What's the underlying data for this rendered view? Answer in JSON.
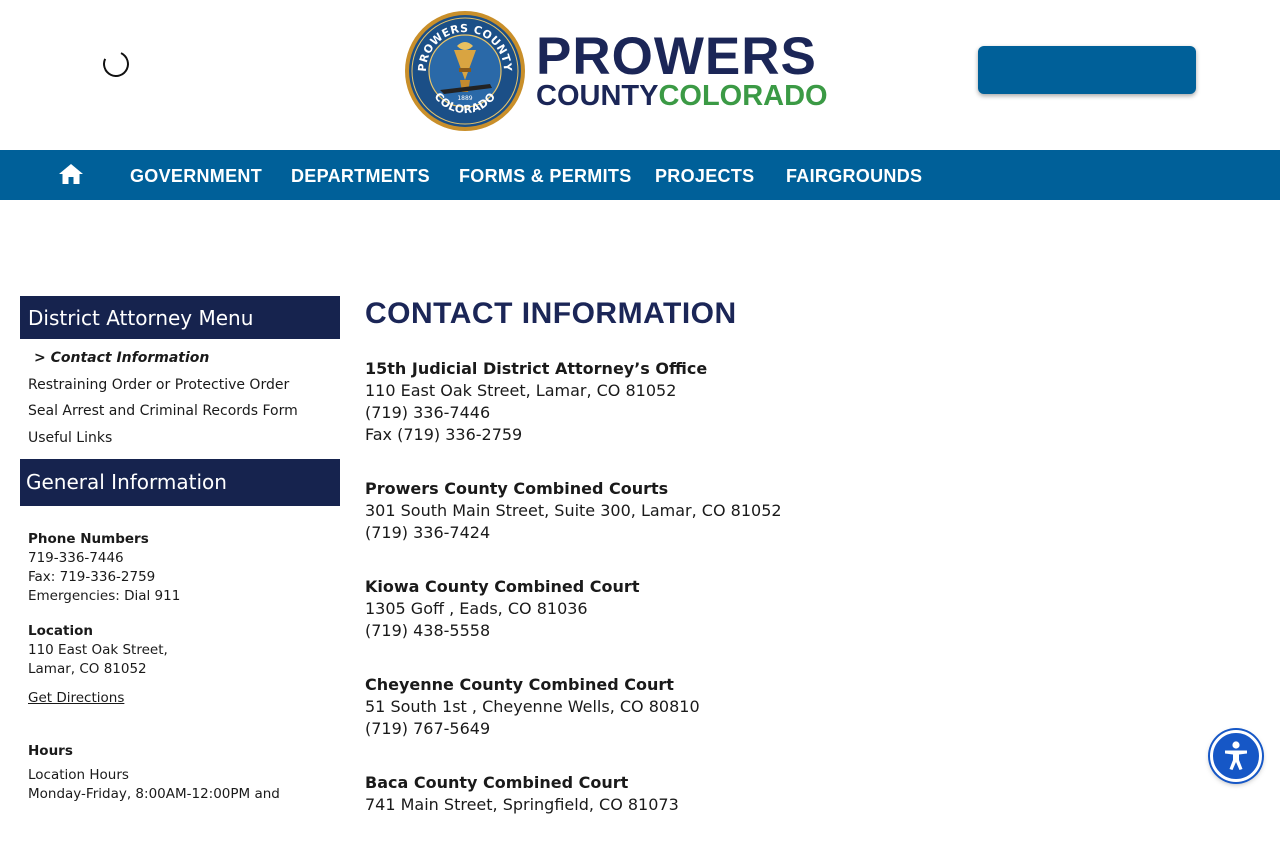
{
  "header": {
    "brand_line1": "PROWERS",
    "brand_county": "COUNTY",
    "brand_colorado": "COLORADO",
    "seal_text_top": "PROWERS COUNTY",
    "seal_text_bottom": "COLORADO",
    "seal_year": "1889"
  },
  "nav": {
    "home_icon": "home-icon",
    "items": [
      {
        "label": "GOVERNMENT"
      },
      {
        "label": "DEPARTMENTS"
      },
      {
        "label": "FORMS & PERMITS"
      },
      {
        "label": "PROJECTS"
      },
      {
        "label": "FAIRGROUNDS"
      }
    ]
  },
  "sidebar": {
    "menu_title": "District Attorney Menu",
    "menu_items": [
      {
        "label": "> Contact Information",
        "current": true
      },
      {
        "label": "Restraining Order or Protective Order"
      },
      {
        "label": "Seal Arrest and Criminal Records Form"
      },
      {
        "label": "Useful Links"
      }
    ],
    "general_title": "General Information",
    "phone_label": "Phone Numbers",
    "phone": "719-336-7446",
    "fax": "Fax: 719-336-2759",
    "emergencies": "Emergencies: Dial 911",
    "location_label": "Location",
    "address_line1": "110 East Oak Street,",
    "address_line2": "Lamar, CO 81052",
    "directions_link": "Get Directions",
    "hours_label": "Hours",
    "hours_line1": "Location Hours",
    "hours_line2": "Monday-Friday, 8:00AM-12:00PM and"
  },
  "main": {
    "title": "CONTACT INFORMATION",
    "offices": [
      {
        "name": "15th Judicial District Attorney’s Office",
        "address": "110 East Oak Street, Lamar, CO 81052",
        "phone": "(719) 336-7446",
        "fax": "Fax (719) 336-2759"
      },
      {
        "name": "Prowers County Combined Courts",
        "address": "301 South Main Street, Suite 300, Lamar, CO 81052",
        "phone": "(719) 336-7424"
      },
      {
        "name": "Kiowa County Combined Court",
        "address": "1305 Goff , Eads, CO 81036",
        "phone": "(719) 438-5558"
      },
      {
        "name": "Cheyenne County Combined Court",
        "address": "51 South 1st , Cheyenne Wells, CO 80810",
        "phone": "(719) 767-5649"
      },
      {
        "name": "Baca County Combined Court",
        "address": "741 Main Street, Springfield, CO 81073"
      }
    ]
  },
  "accessibility_icon": "accessibility-icon",
  "colors": {
    "nav_blue": "#006099",
    "navy": "#1b2657",
    "sidebar_navy": "#16234e",
    "green": "#3b9a45",
    "a11y_blue": "#1657c6"
  }
}
